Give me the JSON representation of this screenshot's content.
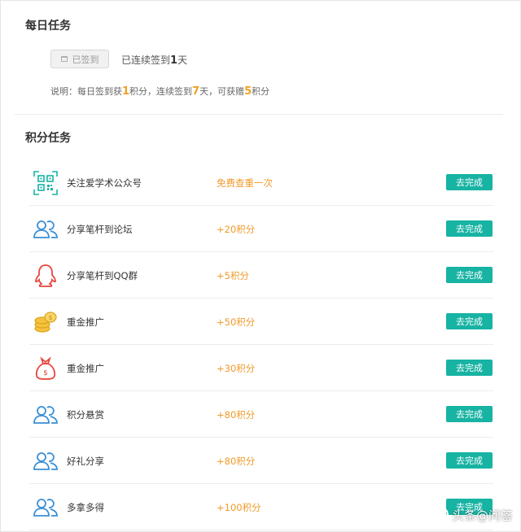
{
  "daily": {
    "title": "每日任务",
    "signed_label": "已签到",
    "streak_prefix": "已连续签到",
    "streak_days": "1",
    "streak_suffix": "天",
    "note_a": "说明：每日签到获",
    "note_b": "1",
    "note_c": "积分，连续签到",
    "note_d": "7",
    "note_e": "天，可获赠",
    "note_f": "5",
    "note_g": "积分"
  },
  "points": {
    "title": "积分任务",
    "action_label": "去完成",
    "tasks": [
      {
        "name": "关注爱学术公众号",
        "reward": "免费查重一次",
        "icon": "qr-code-icon"
      },
      {
        "name": "分享笔杆到论坛",
        "reward": "+20积分",
        "icon": "users-icon"
      },
      {
        "name": "分享笔杆到QQ群",
        "reward": "+5积分",
        "icon": "qq-icon"
      },
      {
        "name": "重金推广",
        "reward": "+50积分",
        "icon": "coins-icon"
      },
      {
        "name": "重金推广",
        "reward": "+30积分",
        "icon": "money-bag-icon"
      },
      {
        "name": "积分悬赏",
        "reward": "+80积分",
        "icon": "users-icon"
      },
      {
        "name": "好礼分享",
        "reward": "+80积分",
        "icon": "users-icon"
      },
      {
        "name": "多拿多得",
        "reward": "+100积分",
        "icon": "users-icon"
      }
    ]
  },
  "watermark": {
    "text": "头条@问答"
  },
  "colors": {
    "accent": "#17b3a3",
    "reward": "#f09a2a",
    "highlight": "#f0a020"
  }
}
